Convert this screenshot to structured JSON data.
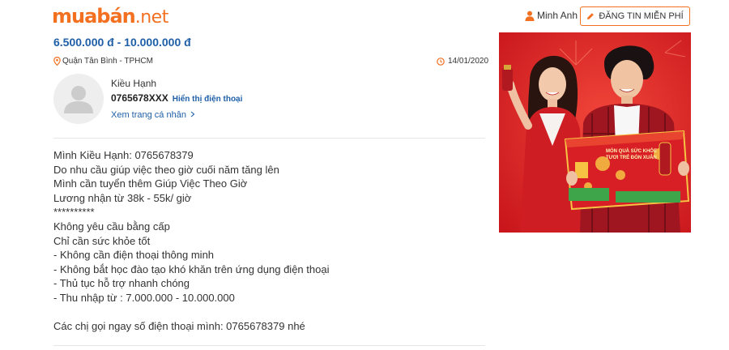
{
  "header": {
    "logo_main": "muabán",
    "logo_tld": ".net",
    "user_name": "Minh Anh",
    "post_button_label": "ĐĂNG TIN MIỄN PHÍ"
  },
  "listing": {
    "price": "6.500.000 đ - 10.000.000 đ",
    "location": "Quận Tân Bình - TPHCM",
    "date": "14/01/2020"
  },
  "seller": {
    "name": "Kiều Hạnh",
    "phone": "0765678XXX",
    "show_phone_label": "Hiển thị điện thoại",
    "profile_link": "Xem trang cá nhân"
  },
  "description": [
    "Mình Kiều Hạnh: 0765678379",
    "Do nhu cầu giúp việc theo giờ cuối năm tăng lên",
    "Mình cần tuyển thêm Giúp Việc Theo Giờ",
    "Lương nhận từ 38k - 55k/ giờ",
    "**********",
    "Không yêu cầu bằng cấp",
    "Chỉ cần sức khỏe tốt",
    "- Không cần điện thoại thông minh",
    "- Không bắt học đào tạo khó khăn trên ứng dụng điện thoại",
    "- Thủ tục hỗ trợ nhanh chóng",
    "- Thu nhập từ : 7.000.000 - 10.000.000",
    "",
    "Các chị gọi ngay số điện thoại mình: 0765678379 nhé"
  ],
  "banner": {
    "box_text_line1": "MÓN QUÀ SỨC KHỎE",
    "box_text_line2": "TƯƠI TRẺ ĐÓN XUÂN"
  },
  "colors": {
    "brand_orange": "#f37021",
    "link_blue": "#1e5fa8",
    "banner_red": "#d81d1d"
  },
  "icons": [
    "user-icon",
    "pencil-icon",
    "map-pin-icon",
    "clock-icon"
  ]
}
